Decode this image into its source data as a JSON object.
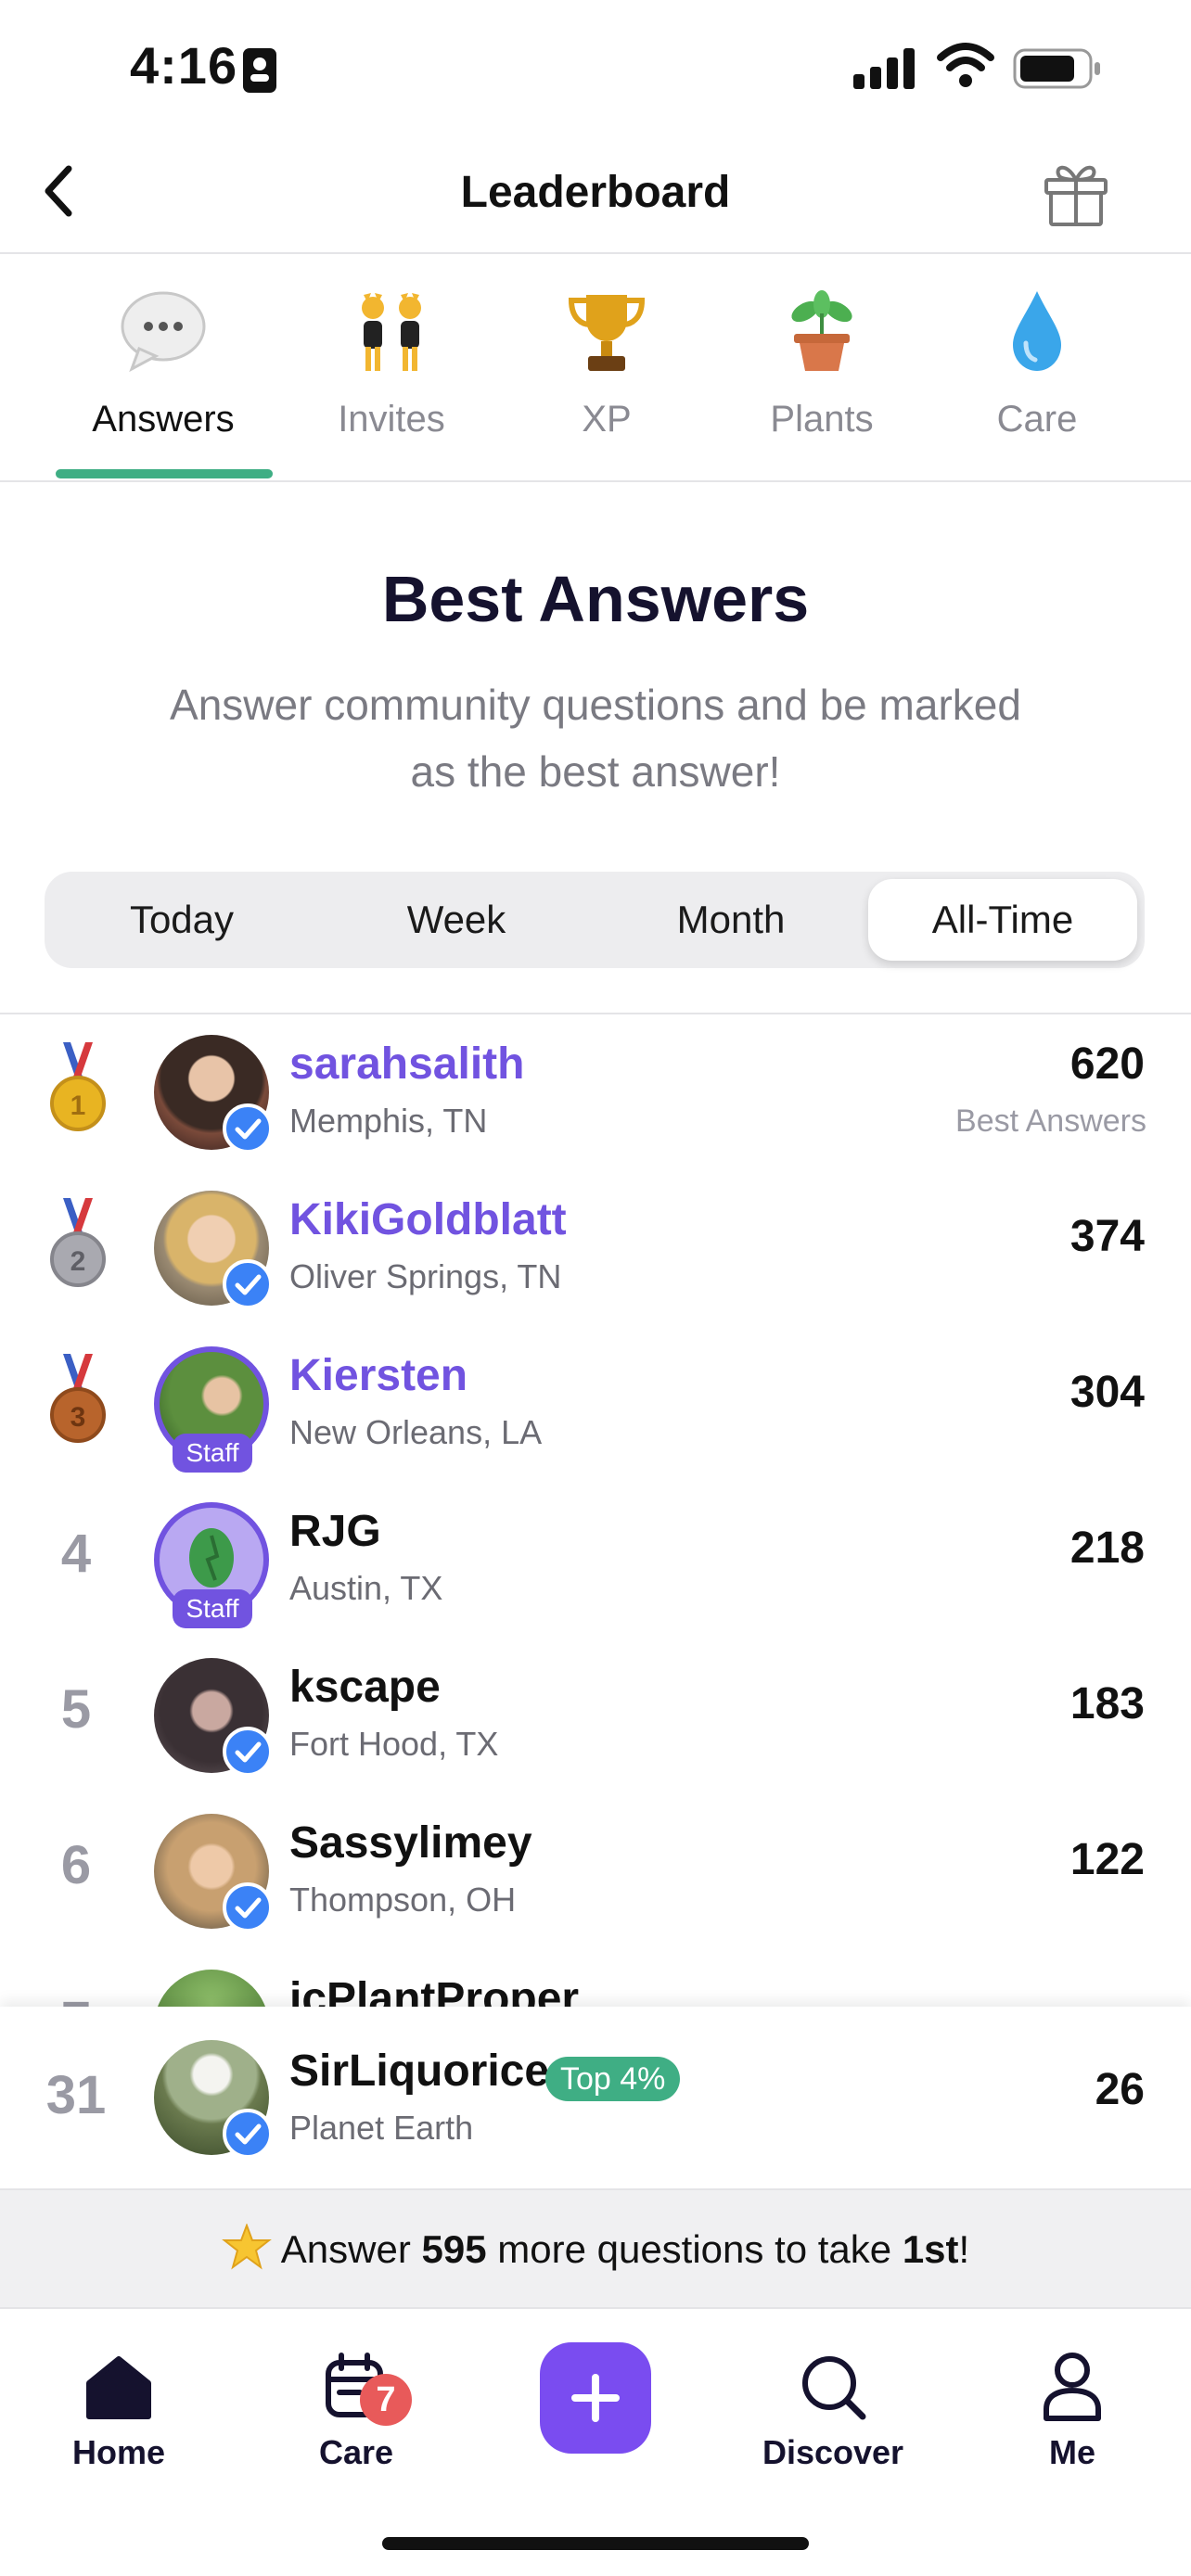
{
  "status_bar": {
    "time": "4:16"
  },
  "header": {
    "title": "Leaderboard"
  },
  "tabs": [
    {
      "label": "Answers",
      "icon": "speech-bubble-icon"
    },
    {
      "label": "Invites",
      "icon": "dancing-people-icon"
    },
    {
      "label": "XP",
      "icon": "trophy-icon"
    },
    {
      "label": "Plants",
      "icon": "potted-plant-icon"
    },
    {
      "label": "Care",
      "icon": "water-drop-icon"
    }
  ],
  "active_tab": "Answers",
  "section": {
    "title": "Best Answers",
    "subtitle_line1": "Answer community questions and be marked",
    "subtitle_line2": "as the best answer!"
  },
  "periods": [
    "Today",
    "Week",
    "Month",
    "All-Time"
  ],
  "active_period": "All-Time",
  "leaderboard": [
    {
      "rank": "1",
      "name": "sarahsalith",
      "location": "Memphis, TN",
      "score": "620",
      "score_caption": "Best Answers",
      "medal": "gold",
      "verified": true
    },
    {
      "rank": "2",
      "name": "KikiGoldblatt",
      "location": "Oliver Springs, TN",
      "score": "374",
      "medal": "silver",
      "verified": true
    },
    {
      "rank": "3",
      "name": "Kiersten",
      "location": "New Orleans, LA",
      "score": "304",
      "medal": "bronze",
      "staff_label": "Staff"
    },
    {
      "rank": "4",
      "name": "RJG",
      "location": "Austin, TX",
      "score": "218",
      "staff_label": "Staff"
    },
    {
      "rank": "5",
      "name": "kscape",
      "location": "Fort Hood, TX",
      "score": "183",
      "verified": true
    },
    {
      "rank": "6",
      "name": "Sassylimey",
      "location": "Thompson, OH",
      "score": "122",
      "verified": true
    },
    {
      "rank": "7",
      "name": "icPlantProper",
      "location": "",
      "score": ""
    }
  ],
  "current_user": {
    "rank": "31",
    "name": "SirLiquorice",
    "badge": "Top 4%",
    "location": "Planet Earth",
    "score": "26",
    "verified": true
  },
  "banner": {
    "prefix": "Answer ",
    "count": "595",
    "middle": " more questions to take ",
    "target": "1st",
    "suffix": "!"
  },
  "bottom_nav": [
    {
      "label": "Home",
      "icon": "home-icon"
    },
    {
      "label": "Care",
      "icon": "calendar-icon",
      "badge": "7"
    },
    {
      "label": "",
      "icon": "plus-icon"
    },
    {
      "label": "Discover",
      "icon": "search-icon"
    },
    {
      "label": "Me",
      "icon": "person-icon"
    }
  ],
  "colors": {
    "accent_purple": "#7153e0",
    "accent_green": "#3fae84",
    "verified_blue": "#3b82f6",
    "badge_red": "#e85a5a"
  }
}
